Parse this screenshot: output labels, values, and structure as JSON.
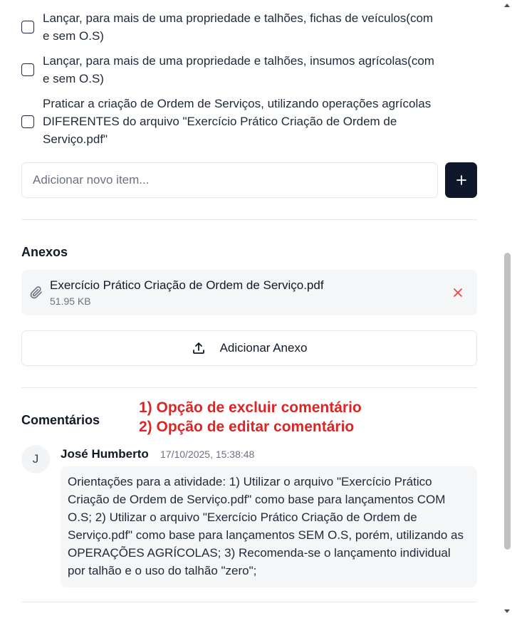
{
  "checklist": {
    "items": [
      {
        "label": "Lançar, para mais de uma propriedade e talhões, fichas de veículos(com e sem O.S)",
        "checked": false
      },
      {
        "label": "Lançar, para mais de uma propriedade e talhões, insumos agrícolas(com e sem O.S)",
        "checked": false
      },
      {
        "label": "Praticar a criação de Ordem de Serviços, utilizando operações agrícolas DIFERENTES do arquivo \"Exercício Prático Criação de Ordem de Serviço.pdf\"",
        "checked": false
      }
    ],
    "new_item_placeholder": "Adicionar novo item...",
    "add_icon": "plus-icon"
  },
  "attachments": {
    "title": "Anexos",
    "files": [
      {
        "name": "Exercício Prático Criação de Ordem de Serviço.pdf",
        "size": "51.95 KB",
        "icon": "paperclip-icon"
      }
    ],
    "add_label": "Adicionar Anexo",
    "add_icon": "upload-icon"
  },
  "comments": {
    "title": "Comentários",
    "annotations": [
      "1) Opção de excluir comentário",
      "2) Opção de editar comentário"
    ],
    "items": [
      {
        "avatar_initial": "J",
        "author": "José Humberto",
        "timestamp": "17/10/2025, 15:38:48",
        "text": "Orientações para a atividade: 1) Utilizar o arquivo \"Exercício Prático Criação de Ordem de Serviço.pdf\" como base para lançamentos COM O.S; 2) Utilizar o arquivo \"Exercício Prático Criação de Ordem de Serviço.pdf\" como base para lançamentos SEM O.S, porém, utilizando as OPERAÇÕES AGRÍCOLAS; 3) Recomenda-se o lançamento individual por talhão e o uso do talhão \"zero\";"
      }
    ]
  },
  "colors": {
    "primary_button": "#0f172a",
    "annotation_red": "#dc2626",
    "remove_red": "#ef4444",
    "card_bg": "#f5f6f8",
    "border": "#e5e7eb"
  }
}
